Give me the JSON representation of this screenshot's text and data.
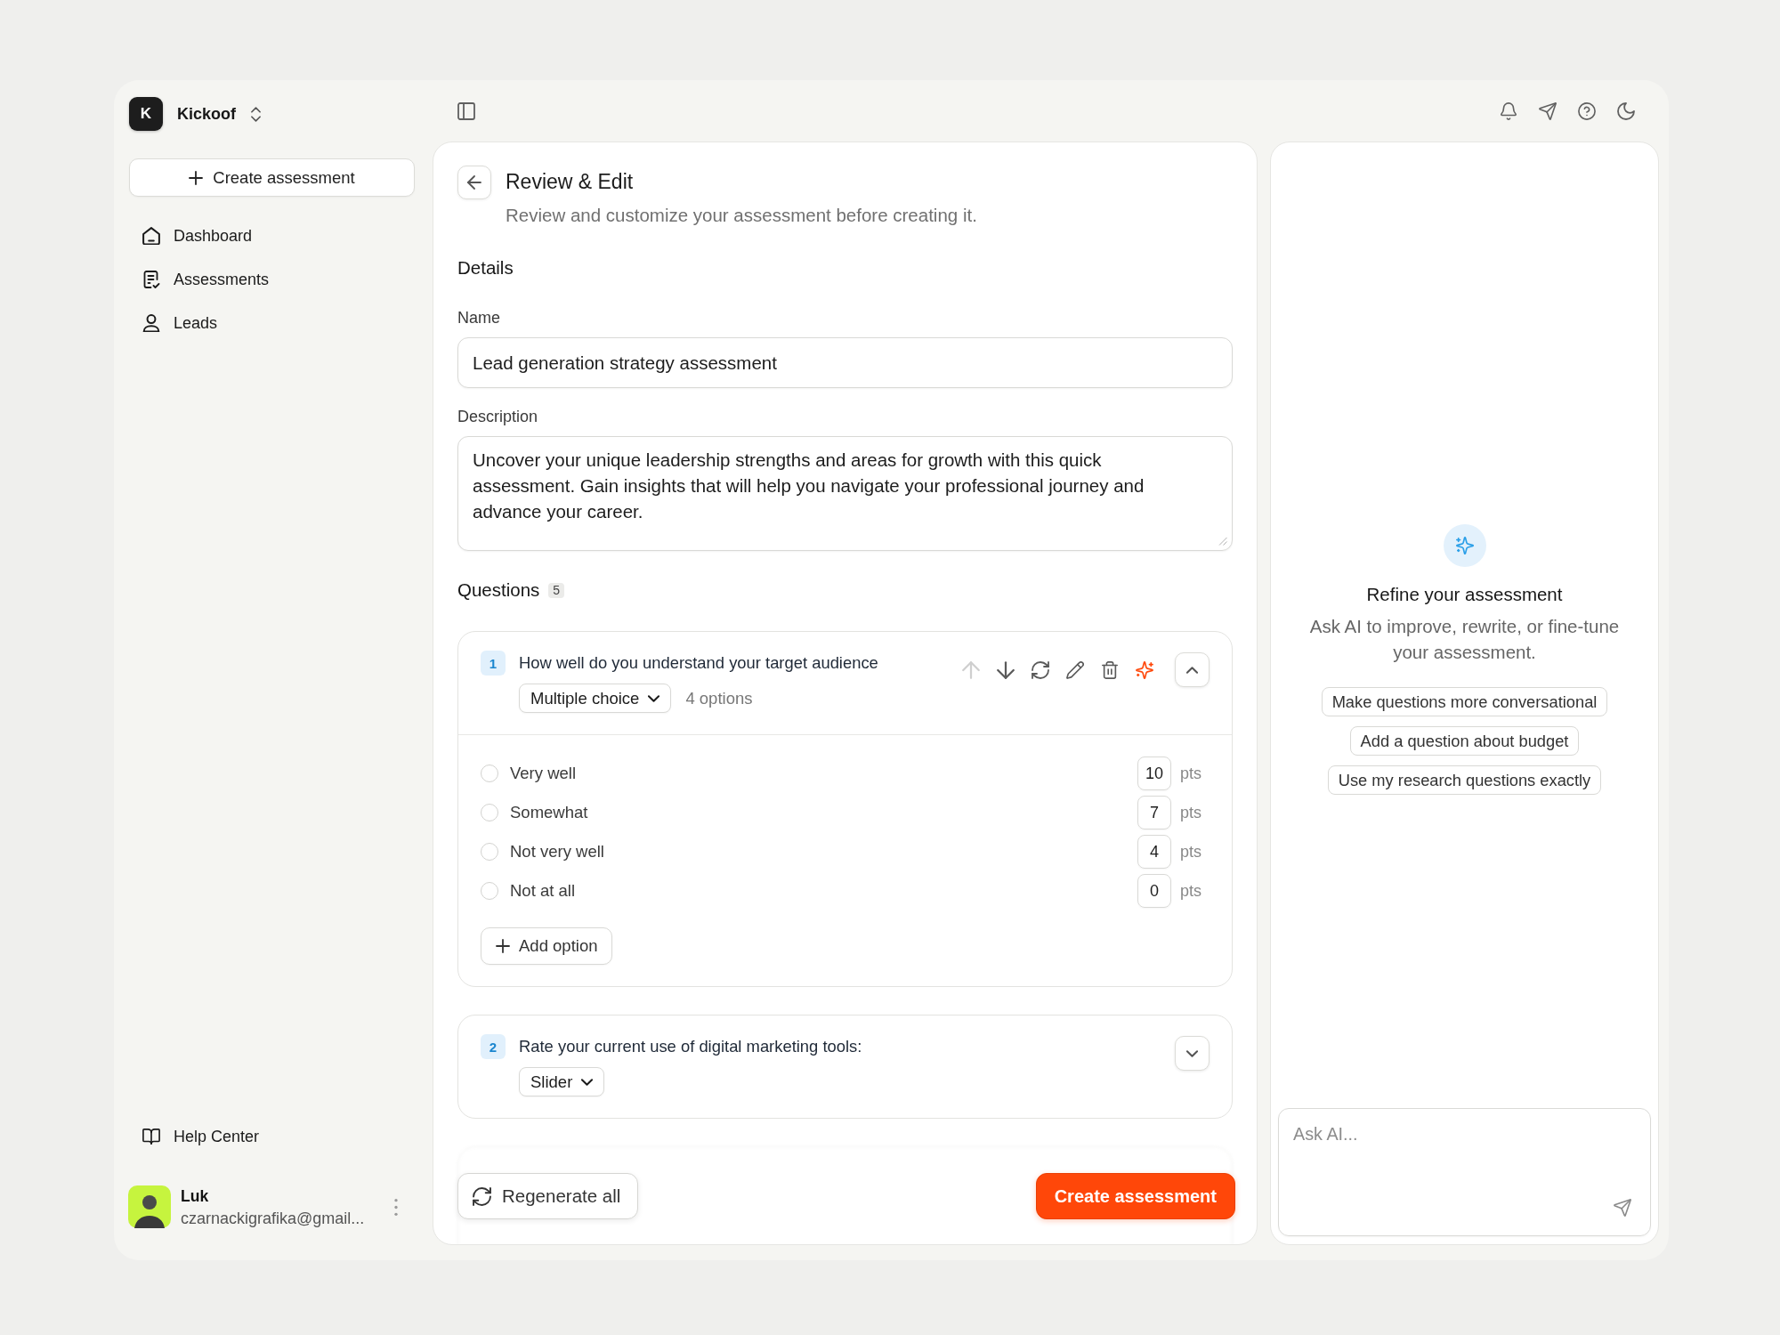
{
  "workspace": {
    "initial": "K",
    "name": "Kickoof"
  },
  "sidebar": {
    "create_button": "Create assessment",
    "items": [
      {
        "label": "Dashboard",
        "selected": false
      },
      {
        "label": "Assessments",
        "selected": false
      },
      {
        "label": "Leads",
        "selected": false
      }
    ],
    "help_link": "Help Center",
    "user": {
      "name": "Luk",
      "email": "czarnackigrafika@gmail..."
    }
  },
  "editor": {
    "title": "Review & Edit",
    "subtitle": "Review and customize your assessment before creating it.",
    "details_heading": "Details",
    "name": {
      "label": "Name",
      "value": "Lead generation strategy assessment"
    },
    "description": {
      "label": "Description",
      "value": "Uncover your unique leadership strengths and areas for growth with this quick assessment. Gain insights that will help you navigate your professional journey and advance your career."
    },
    "questions": {
      "heading": "Questions",
      "count": "5",
      "items": [
        {
          "number": "1",
          "text": "How well do you understand your target audience",
          "type": "Multiple choice",
          "option_count": "4 options",
          "expanded": true,
          "move_up_disabled": true,
          "options": [
            {
              "label": "Very well",
              "selected": false,
              "points": "10",
              "unit": "pts"
            },
            {
              "label": "Somewhat",
              "selected": false,
              "points": "7",
              "unit": "pts"
            },
            {
              "label": "Not very well",
              "selected": false,
              "points": "4",
              "unit": "pts"
            },
            {
              "label": "Not at all",
              "selected": false,
              "points": "0",
              "unit": "pts"
            }
          ],
          "add_option": "Add option"
        },
        {
          "number": "2",
          "text": "Rate your current use of digital marketing tools:",
          "type": "Slider",
          "expanded": false
        }
      ]
    },
    "footer": {
      "regenerate_button": "Regenerate all",
      "create_button": "Create assessment"
    }
  },
  "assistant": {
    "title": "Refine your assessment",
    "description": "Ask AI to improve, rewrite, or fine-tune your assessment.",
    "suggestions": [
      "Make questions more conversational",
      "Add a question about budget",
      "Use my research questions exactly"
    ],
    "input": {
      "placeholder": "Ask AI..."
    }
  }
}
